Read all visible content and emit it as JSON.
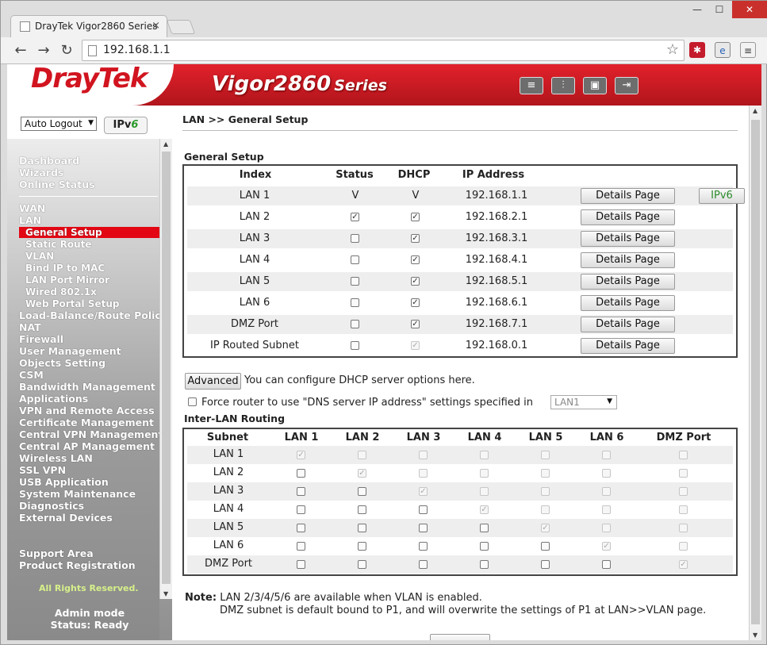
{
  "browser": {
    "tab_title": "DrayTek Vigor2860 Series",
    "tab_close": "×",
    "address": "192.168.1.1",
    "min": "—",
    "max": "☐",
    "close": "✕",
    "back": "←",
    "forward": "→",
    "reload": "↻",
    "star": "☆",
    "ext1": "✱",
    "ext2": "e",
    "menu": "≡"
  },
  "banner": {
    "logo": "DrayTek",
    "model": "Vigor2860",
    "series": "Series",
    "icons": [
      "≡",
      "⫶",
      "▣",
      "⇥"
    ]
  },
  "sidebar": {
    "autologout": "Auto Logout",
    "arrow": "▼",
    "ipv6_prefix": "IPv",
    "ipv6_six": "6",
    "groups1": [
      "Dashboard",
      "Wizards",
      "Online Status"
    ],
    "wan": "WAN",
    "lan": "LAN",
    "lan_subs": [
      "General Setup",
      "Static Route",
      "VLAN",
      "Bind IP to MAC",
      "LAN Port Mirror",
      "Wired 802.1x",
      "Web Portal Setup"
    ],
    "items": [
      "Load-Balance/Route Policy",
      "NAT",
      "Firewall",
      "User Management",
      "Objects Setting",
      "CSM",
      "Bandwidth Management",
      "Applications",
      "VPN and Remote Access",
      "Certificate Management",
      "Central VPN Management",
      "Central AP Management",
      "Wireless LAN",
      "SSL VPN",
      "USB Application",
      "System Maintenance",
      "Diagnostics",
      "External Devices"
    ],
    "support": "Support Area",
    "product": "Product Registration",
    "rights": "All Rights Reserved.",
    "admin_mode": "Admin mode",
    "status": "Status: Ready"
  },
  "main": {
    "breadcrumb": "LAN >> General Setup",
    "gs_title": "General Setup",
    "gs_headers": [
      "Index",
      "Status",
      "DHCP",
      "IP Address"
    ],
    "details_label": "Details Page",
    "ipv6_label": "IPv6",
    "lans": [
      {
        "index": "LAN 1",
        "status": "V",
        "dhcp": "V",
        "ip": "192.168.1.1"
      },
      {
        "index": "LAN 2",
        "status": "checked",
        "dhcp": "checked",
        "ip": "192.168.2.1"
      },
      {
        "index": "LAN 3",
        "status": "unchecked",
        "dhcp": "checked",
        "ip": "192.168.3.1"
      },
      {
        "index": "LAN 4",
        "status": "unchecked",
        "dhcp": "checked",
        "ip": "192.168.4.1"
      },
      {
        "index": "LAN 5",
        "status": "unchecked",
        "dhcp": "checked",
        "ip": "192.168.5.1"
      },
      {
        "index": "LAN 6",
        "status": "unchecked",
        "dhcp": "checked",
        "ip": "192.168.6.1"
      },
      {
        "index": "DMZ Port",
        "status": "unchecked",
        "dhcp": "checked",
        "ip": "192.168.7.1"
      },
      {
        "index": "IP Routed Subnet",
        "status": "unchecked",
        "dhcp": "checked-disabled",
        "ip": "192.168.0.1"
      }
    ],
    "advanced_label": "Advanced",
    "advanced_text": "You can configure DHCP server options here.",
    "force_text": "Force router to use \"DNS server IP address\" settings specified in",
    "force_select": "LAN1",
    "ilr_title": "Inter-LAN Routing",
    "ilr_headers": [
      "Subnet",
      "LAN 1",
      "LAN 2",
      "LAN 3",
      "LAN 4",
      "LAN 5",
      "LAN 6",
      "DMZ Port"
    ],
    "ilr_rows": [
      "LAN 1",
      "LAN 2",
      "LAN 3",
      "LAN 4",
      "LAN 5",
      "LAN 6",
      "DMZ Port"
    ],
    "note_label": "Note:",
    "note_line1": "LAN 2/3/4/5/6 are available when VLAN is enabled.",
    "note_line2": "DMZ subnet is default bound to P1, and will overwrite the settings of P1 at LAN>>VLAN page."
  }
}
